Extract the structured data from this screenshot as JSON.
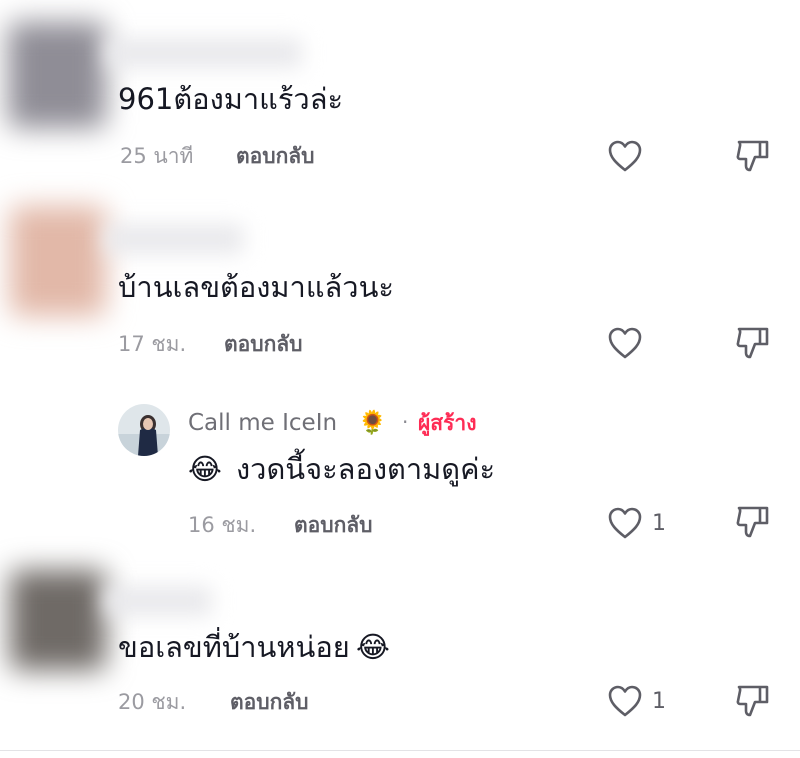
{
  "comments": [
    {
      "text": "961ต้องมาแร้วล่ะ",
      "time": "25 นาที",
      "reply_label": "ตอบกลับ",
      "like_count": "",
      "avatar_color": "#8f8d96"
    },
    {
      "text": "บ้านเลขต้องมาแล้วนะ",
      "time": "17 ชม.",
      "reply_label": "ตอบกลับ",
      "like_count": "",
      "avatar_color": "#e2b8a8",
      "replies": [
        {
          "username": "Call me IceIn",
          "username_emoji": "🌻",
          "separator": "·",
          "creator_badge": "ผู้สร้าง",
          "text_emoji": "😂",
          "text": "งวดนี้จะลองตามดูค่ะ",
          "time": "16 ชม.",
          "reply_label": "ตอบกลับ",
          "like_count": "1"
        }
      ]
    },
    {
      "text": "ขอเลขที่บ้านหน่อย",
      "text_emoji": "😂",
      "time": "20 ชม.",
      "reply_label": "ตอบกลับ",
      "like_count": "1",
      "avatar_color": "#6f6a66"
    }
  ],
  "colors": {
    "creator_badge": "#fe2c55",
    "icon": "#5e5e66",
    "meta_text": "#9b9ba1"
  },
  "icons": [
    "heart-outline-icon",
    "dislike-icon"
  ]
}
